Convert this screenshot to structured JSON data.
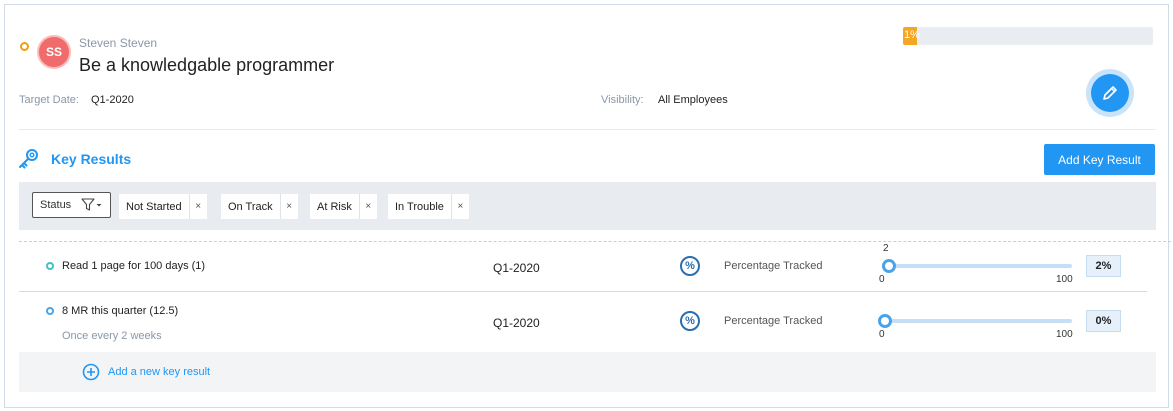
{
  "goal": {
    "owner_initials": "SS",
    "owner_name": "Steven Steven",
    "title": "Be a knowledgable programmer",
    "progress_label": "1%",
    "progress_value": 0.01,
    "target_date_label": "Target Date:",
    "target_date_value": "Q1-2020",
    "visibility_label": "Visibility:",
    "visibility_value": "All Employees",
    "status_color": "#f39c12",
    "accent_color": "#2196f3"
  },
  "key_results_section": {
    "heading": "Key Results",
    "add_button_label": "Add Key Result"
  },
  "filters": {
    "status_label": "Status",
    "chips": [
      {
        "label": "Not Started",
        "remove": "×"
      },
      {
        "label": "On Track",
        "remove": "×"
      },
      {
        "label": "At Risk",
        "remove": "×"
      },
      {
        "label": "In Trouble",
        "remove": "×"
      }
    ]
  },
  "key_results": [
    {
      "title": "Read 1 page for 100 days (1)",
      "subtitle": "",
      "date": "Q1-2020",
      "tracking": "Percentage Tracked",
      "current_label": "2",
      "current_value": 2,
      "min_label": "0",
      "max_label": "100",
      "percent": "2%",
      "dot_color": "#3fc1c9"
    },
    {
      "title": "8 MR this quarter (12.5)",
      "subtitle": "Once every 2 weeks",
      "date": "Q1-2020",
      "tracking": "Percentage Tracked",
      "current_label": "",
      "current_value": 0,
      "min_label": "0",
      "max_label": "100",
      "percent": "0%",
      "dot_color": "#4aa3e8"
    }
  ],
  "add_new": {
    "label": "Add a new key result"
  }
}
